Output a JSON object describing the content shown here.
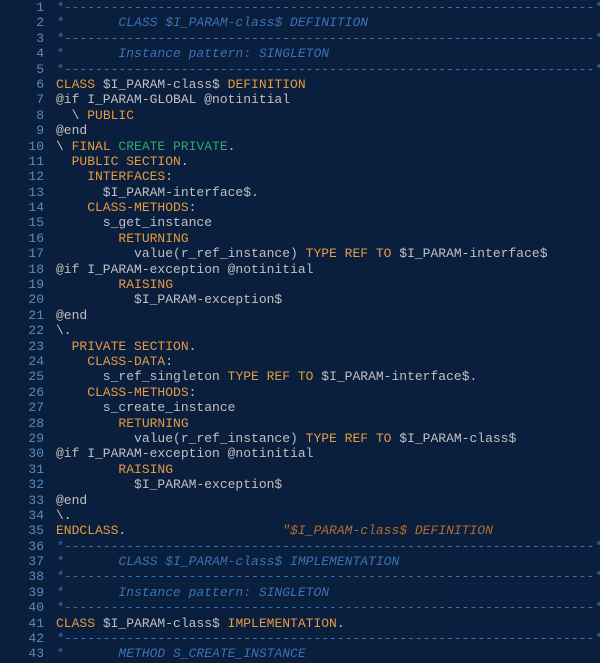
{
  "lines": [
    {
      "n": "1",
      "tokens": [
        {
          "c": "comment-dash",
          "t": "*--------------------------------------------------------------------*"
        }
      ]
    },
    {
      "n": "2",
      "tokens": [
        {
          "c": "comment",
          "t": "*       CLASS $I_PARAM-class$ DEFINITION"
        }
      ]
    },
    {
      "n": "3",
      "tokens": [
        {
          "c": "comment-dash",
          "t": "*--------------------------------------------------------------------*"
        }
      ]
    },
    {
      "n": "4",
      "tokens": [
        {
          "c": "comment",
          "t": "*       Instance pattern: SINGLETON"
        }
      ]
    },
    {
      "n": "5",
      "tokens": [
        {
          "c": "comment-dash",
          "t": "*--------------------------------------------------------------------*"
        }
      ]
    },
    {
      "n": "6",
      "tokens": [
        {
          "c": "keyword",
          "t": "CLASS "
        },
        {
          "c": "paramlit",
          "t": "$I_PARAM-class$"
        },
        {
          "c": "keyword",
          "t": " DEFINITION"
        }
      ]
    },
    {
      "n": "7",
      "tokens": [
        {
          "c": "neutral",
          "t": "@if I_PARAM-GLOBAL @notinitial"
        }
      ]
    },
    {
      "n": "8",
      "tokens": [
        {
          "c": "bslash",
          "t": "  \\ "
        },
        {
          "c": "keyword",
          "t": "PUBLIC"
        }
      ]
    },
    {
      "n": "9",
      "tokens": [
        {
          "c": "neutral",
          "t": "@end"
        }
      ]
    },
    {
      "n": "10",
      "tokens": [
        {
          "c": "bslash",
          "t": "\\ "
        },
        {
          "c": "keyword",
          "t": "FINAL"
        },
        {
          "c": "green",
          "t": " CREATE PRIVATE"
        },
        {
          "c": "neutral",
          "t": "."
        }
      ]
    },
    {
      "n": "11",
      "tokens": [
        {
          "c": "keyword",
          "t": "  PUBLIC SECTION"
        },
        {
          "c": "neutral",
          "t": "."
        }
      ]
    },
    {
      "n": "12",
      "tokens": [
        {
          "c": "keyword",
          "t": "    INTERFACES"
        },
        {
          "c": "neutral",
          "t": ":"
        }
      ]
    },
    {
      "n": "13",
      "tokens": [
        {
          "c": "neutral",
          "t": "      $I_PARAM-interface$."
        }
      ]
    },
    {
      "n": "14",
      "tokens": [
        {
          "c": "keyword",
          "t": "    CLASS-METHODS"
        },
        {
          "c": "neutral",
          "t": ":"
        }
      ]
    },
    {
      "n": "15",
      "tokens": [
        {
          "c": "neutral",
          "t": "      s_get_instance"
        }
      ]
    },
    {
      "n": "16",
      "tokens": [
        {
          "c": "keyword",
          "t": "        RETURNING"
        }
      ]
    },
    {
      "n": "17",
      "tokens": [
        {
          "c": "neutral",
          "t": "          value(r_ref_instance) "
        },
        {
          "c": "keyword",
          "t": "TYPE REF TO"
        },
        {
          "c": "neutral",
          "t": " $I_PARAM-interface$"
        }
      ]
    },
    {
      "n": "18",
      "tokens": [
        {
          "c": "neutral",
          "t": "@if I_PARAM-exception @notinitial"
        }
      ]
    },
    {
      "n": "19",
      "tokens": [
        {
          "c": "keyword",
          "t": "        RAISING"
        }
      ]
    },
    {
      "n": "20",
      "tokens": [
        {
          "c": "neutral",
          "t": "          $I_PARAM-exception$"
        }
      ]
    },
    {
      "n": "21",
      "tokens": [
        {
          "c": "neutral",
          "t": "@end"
        }
      ]
    },
    {
      "n": "22",
      "tokens": [
        {
          "c": "bslash",
          "t": "\\."
        }
      ]
    },
    {
      "n": "23",
      "tokens": [
        {
          "c": "keyword",
          "t": "  PRIVATE SECTION"
        },
        {
          "c": "neutral",
          "t": "."
        }
      ]
    },
    {
      "n": "24",
      "tokens": [
        {
          "c": "keyword",
          "t": "    CLASS-DATA"
        },
        {
          "c": "neutral",
          "t": ":"
        }
      ]
    },
    {
      "n": "25",
      "tokens": [
        {
          "c": "neutral",
          "t": "      s_ref_singleton "
        },
        {
          "c": "keyword",
          "t": "TYPE REF TO"
        },
        {
          "c": "neutral",
          "t": " $I_PARAM-interface$."
        }
      ]
    },
    {
      "n": "26",
      "tokens": [
        {
          "c": "keyword",
          "t": "    CLASS-METHODS"
        },
        {
          "c": "neutral",
          "t": ":"
        }
      ]
    },
    {
      "n": "27",
      "tokens": [
        {
          "c": "neutral",
          "t": "      s_create_instance"
        }
      ]
    },
    {
      "n": "28",
      "tokens": [
        {
          "c": "keyword",
          "t": "        RETURNING"
        }
      ]
    },
    {
      "n": "29",
      "tokens": [
        {
          "c": "neutral",
          "t": "          value(r_ref_instance) "
        },
        {
          "c": "keyword",
          "t": "TYPE REF TO"
        },
        {
          "c": "neutral",
          "t": " $I_PARAM-class$"
        }
      ]
    },
    {
      "n": "30",
      "tokens": [
        {
          "c": "neutral",
          "t": "@if I_PARAM-exception @notinitial"
        }
      ]
    },
    {
      "n": "31",
      "tokens": [
        {
          "c": "keyword",
          "t": "        RAISING"
        }
      ]
    },
    {
      "n": "32",
      "tokens": [
        {
          "c": "neutral",
          "t": "          $I_PARAM-exception$"
        }
      ]
    },
    {
      "n": "33",
      "tokens": [
        {
          "c": "neutral",
          "t": "@end"
        }
      ]
    },
    {
      "n": "34",
      "tokens": [
        {
          "c": "bslash",
          "t": "\\."
        }
      ]
    },
    {
      "n": "35",
      "tokens": [
        {
          "c": "keyword",
          "t": "ENDCLASS"
        },
        {
          "c": "neutral",
          "t": ".                    "
        },
        {
          "c": "string",
          "t": "\"$I_PARAM-class$ DEFINITION"
        }
      ]
    },
    {
      "n": "36",
      "tokens": [
        {
          "c": "comment-dash",
          "t": "*--------------------------------------------------------------------*"
        }
      ]
    },
    {
      "n": "37",
      "tokens": [
        {
          "c": "comment",
          "t": "*       CLASS $I_PARAM-class$ IMPLEMENTATION"
        }
      ]
    },
    {
      "n": "38",
      "tokens": [
        {
          "c": "comment-dash",
          "t": "*--------------------------------------------------------------------*"
        }
      ]
    },
    {
      "n": "39",
      "tokens": [
        {
          "c": "comment",
          "t": "*       Instance pattern: SINGLETON"
        }
      ]
    },
    {
      "n": "40",
      "tokens": [
        {
          "c": "comment-dash",
          "t": "*--------------------------------------------------------------------*"
        }
      ]
    },
    {
      "n": "41",
      "tokens": [
        {
          "c": "keyword",
          "t": "CLASS "
        },
        {
          "c": "paramlit",
          "t": "$I_PARAM-class$"
        },
        {
          "c": "keyword",
          "t": " IMPLEMENTATION"
        },
        {
          "c": "neutral",
          "t": "."
        }
      ]
    },
    {
      "n": "42",
      "tokens": [
        {
          "c": "comment-dash",
          "t": "*--------------------------------------------------------------------*"
        }
      ]
    },
    {
      "n": "43",
      "tokens": [
        {
          "c": "comment",
          "t": "*       METHOD S_CREATE_INSTANCE"
        }
      ]
    }
  ]
}
